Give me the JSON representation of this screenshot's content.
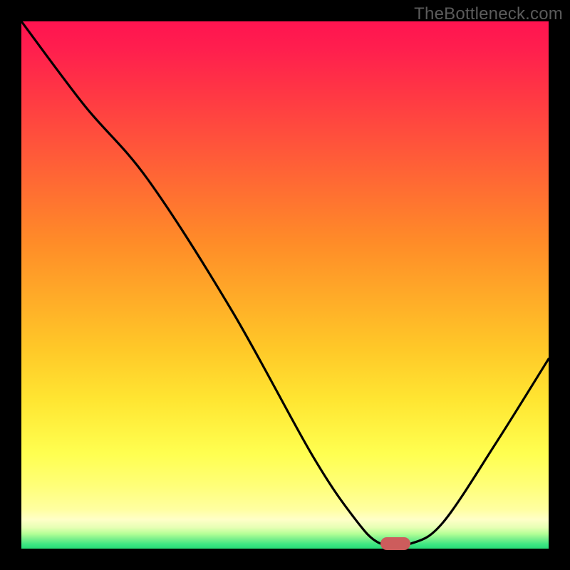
{
  "watermark": "TheBottleneck.com",
  "chart_data": {
    "type": "line",
    "title": "",
    "xlabel": "",
    "ylabel": "",
    "xlim": [
      0,
      1
    ],
    "ylim": [
      0,
      1
    ],
    "background_gradient_stops": [
      {
        "pos": 0.0,
        "color": "#ff1450"
      },
      {
        "pos": 0.12,
        "color": "#ff3246"
      },
      {
        "pos": 0.32,
        "color": "#ff6e32"
      },
      {
        "pos": 0.52,
        "color": "#ffaa28"
      },
      {
        "pos": 0.72,
        "color": "#ffe632"
      },
      {
        "pos": 0.88,
        "color": "#ffff78"
      },
      {
        "pos": 0.98,
        "color": "#78f08c"
      },
      {
        "pos": 1.0,
        "color": "#28dc78"
      }
    ],
    "series": [
      {
        "name": "bottleneck-curve",
        "x": [
          0.0,
          0.12,
          0.24,
          0.4,
          0.55,
          0.63,
          0.68,
          0.74,
          0.8,
          0.9,
          1.0
        ],
        "y": [
          1.0,
          0.84,
          0.7,
          0.45,
          0.18,
          0.06,
          0.01,
          0.01,
          0.05,
          0.2,
          0.36
        ]
      }
    ],
    "marker": {
      "name": "optimal-point",
      "x": 0.71,
      "y": 0.01,
      "color": "#cd5c5c",
      "shape": "pill"
    }
  }
}
